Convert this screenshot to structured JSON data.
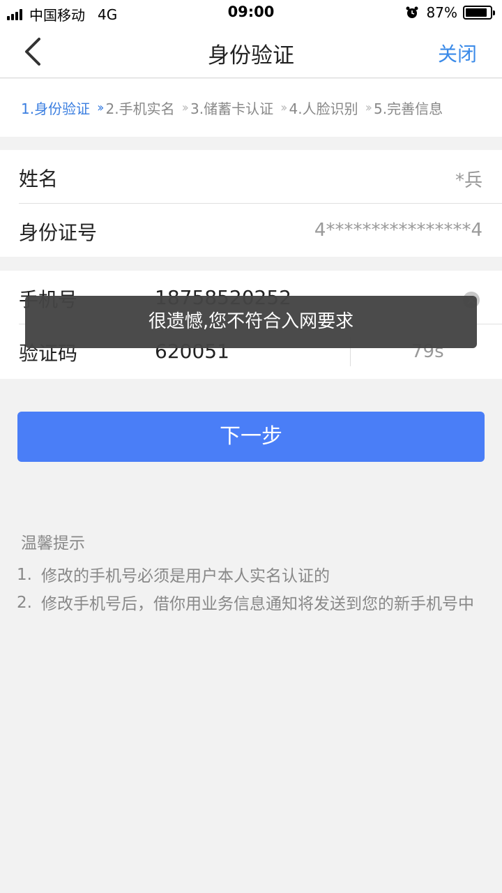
{
  "status_bar": {
    "carrier": "中国移动",
    "network": "4G",
    "time": "09:00",
    "battery_percent_label": "87%",
    "battery_level": 0.87
  },
  "nav": {
    "title": "身份验证",
    "close_label": "关闭"
  },
  "steps": [
    {
      "label": "1.身份验证",
      "active": true
    },
    {
      "label": "2.手机实名",
      "active": false
    },
    {
      "label": "3.储蓄卡认证",
      "active": false
    },
    {
      "label": "4.人脸识别",
      "active": false
    },
    {
      "label": "5.完善信息",
      "active": false
    }
  ],
  "form": {
    "name_label": "姓名",
    "name_value": "*兵",
    "id_label": "身份证号",
    "id_value": "4****************4",
    "phone_label": "手机号",
    "phone_value": "18758520252",
    "code_label": "验证码",
    "code_value": "620051",
    "countdown": "79s"
  },
  "toast": {
    "message": "很遗憾,您不符合入网要求"
  },
  "next_button": {
    "label": "下一步"
  },
  "tips": {
    "title": "温馨提示",
    "items": [
      {
        "num": "1.",
        "text": "修改的手机号必须是用户本人实名认证的"
      },
      {
        "num": "2.",
        "text": "修改手机号后，借你用业务信息通知将发送到您的新手机号中"
      }
    ]
  },
  "colors": {
    "accent": "#3a7ee0",
    "button": "#4a7ef7",
    "close": "#3a8ae8"
  }
}
